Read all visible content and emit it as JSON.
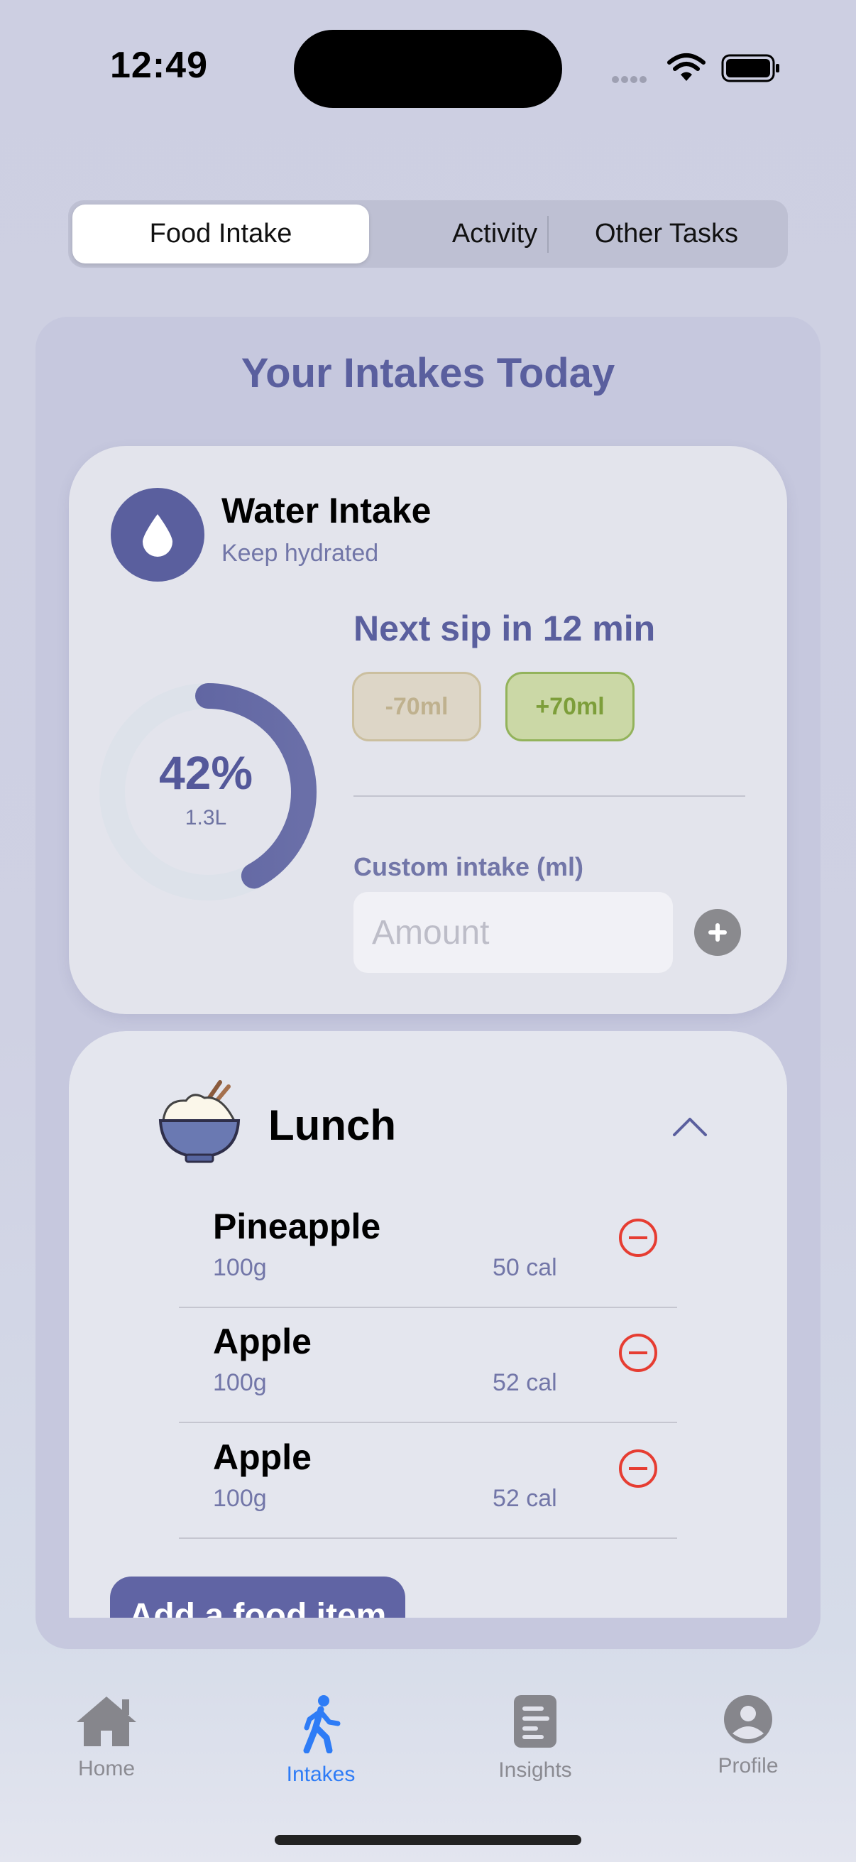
{
  "status_bar": {
    "time": "12:49"
  },
  "segments": [
    {
      "label": "Food Intake",
      "active": true
    },
    {
      "label": "Activity",
      "active": false
    },
    {
      "label": "Other Tasks",
      "active": false
    }
  ],
  "main": {
    "title": "Your Intakes Today"
  },
  "water": {
    "title": "Water Intake",
    "subtitle": "Keep hydrated",
    "progress_percent": 42,
    "progress_label": "42%",
    "amount_label": "1.3L",
    "next_sip": "Next sip in 12 min",
    "minus_label": "-70ml",
    "plus_label": "+70ml",
    "custom_label": "Custom intake (ml)",
    "amount_placeholder": "Amount"
  },
  "meal": {
    "title": "Lunch",
    "items": [
      {
        "name": "Pineapple",
        "qty": "100g",
        "cal": "50 cal"
      },
      {
        "name": "Apple",
        "qty": "100g",
        "cal": "52 cal"
      },
      {
        "name": "Apple",
        "qty": "100g",
        "cal": "52 cal"
      }
    ],
    "add_label": "Add a food item"
  },
  "tabbar": [
    {
      "label": "Home",
      "icon": "house-icon",
      "active": false
    },
    {
      "label": "Intakes",
      "icon": "walking-person-icon",
      "active": true
    },
    {
      "label": "Insights",
      "icon": "document-icon",
      "active": false
    },
    {
      "label": "Profile",
      "icon": "person-circle-icon",
      "active": false
    }
  ],
  "colors": {
    "accent": "#5a5f9e",
    "tab_active": "#2e7cf6",
    "remove": "#e63d32",
    "plus_green": "#93b35b"
  }
}
